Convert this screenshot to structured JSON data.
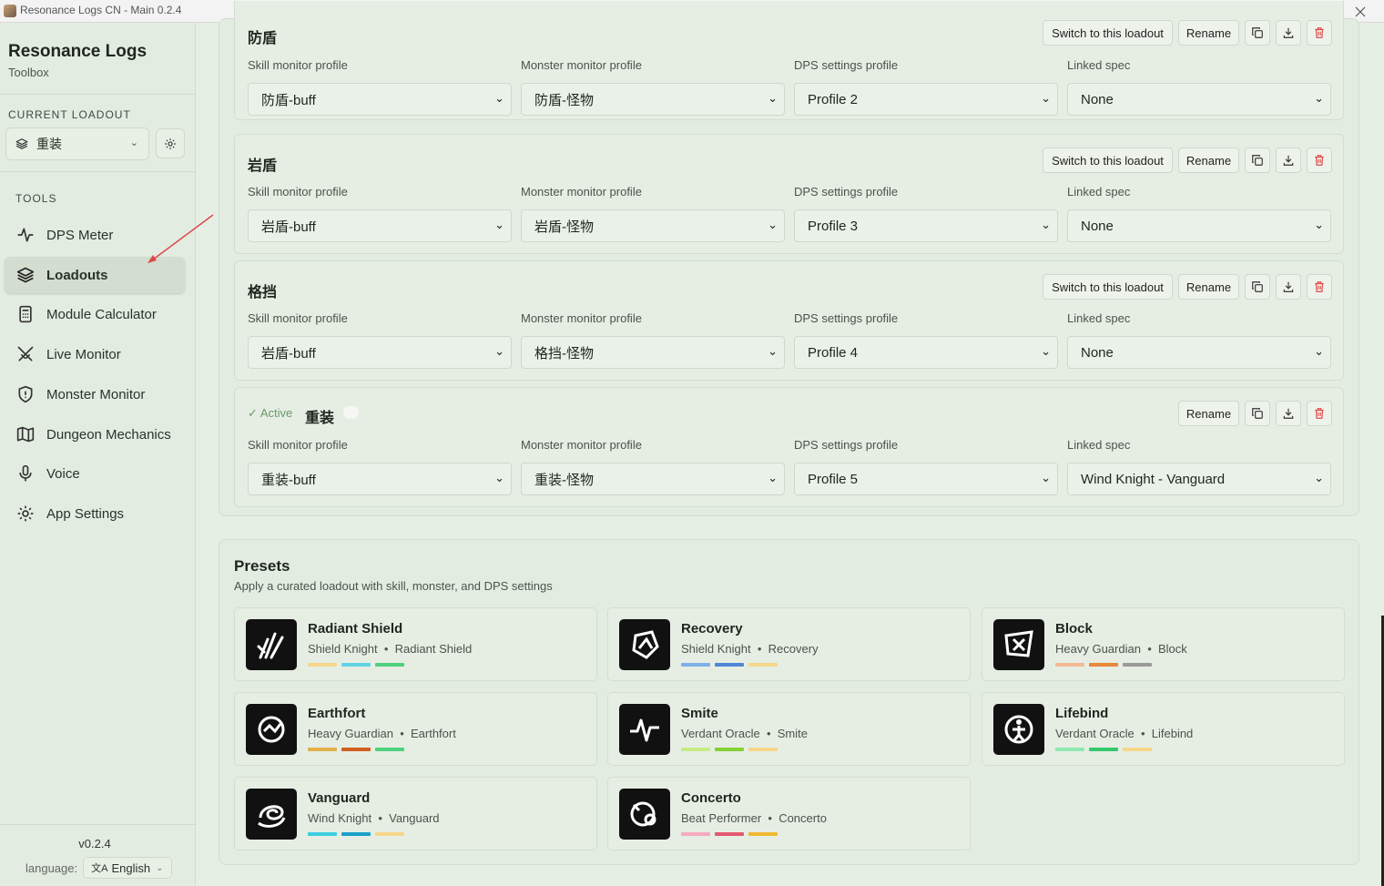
{
  "window": {
    "title": "Resonance Logs CN - Main 0.2.4"
  },
  "sidebar": {
    "app_name": "Resonance Logs",
    "app_sub": "Toolbox",
    "current_loadout_label": "CURRENT LOADOUT",
    "current_loadout_value": "重装",
    "tools_label": "TOOLS",
    "items": [
      {
        "label": "DPS Meter",
        "icon": "pulse-icon"
      },
      {
        "label": "Loadouts",
        "icon": "layers-icon"
      },
      {
        "label": "Module Calculator",
        "icon": "calculator-icon"
      },
      {
        "label": "Live Monitor",
        "icon": "swords-icon"
      },
      {
        "label": "Monster Monitor",
        "icon": "shield-icon"
      },
      {
        "label": "Dungeon Mechanics",
        "icon": "map-icon"
      },
      {
        "label": "Voice",
        "icon": "mic-icon"
      },
      {
        "label": "App Settings",
        "icon": "gear-icon"
      }
    ],
    "version": "v0.2.4",
    "language_label": "language:",
    "language_value": "English"
  },
  "labels": {
    "skill": "Skill monitor profile",
    "monster": "Monster monitor profile",
    "dps": "DPS settings profile",
    "spec": "Linked spec",
    "switch": "Switch to this loadout",
    "rename": "Rename",
    "active": "Active"
  },
  "loadouts": [
    {
      "name": "防盾",
      "skill": "防盾-buff",
      "monster": "防盾-怪物",
      "dps": "Profile 2",
      "spec": "None"
    },
    {
      "name": "岩盾",
      "skill": "岩盾-buff",
      "monster": "岩盾-怪物",
      "dps": "Profile 3",
      "spec": "None"
    },
    {
      "name": "格挡",
      "skill": "岩盾-buff",
      "monster": "格挡-怪物",
      "dps": "Profile 4",
      "spec": "None"
    },
    {
      "name": "重装",
      "skill": "重装-buff",
      "monster": "重装-怪物",
      "dps": "Profile 5",
      "spec": "Wind Knight - Vanguard"
    }
  ],
  "presets": {
    "title": "Presets",
    "subtitle": "Apply a curated loadout with skill, monster, and DPS settings",
    "separator": "•",
    "items": [
      {
        "name": "Radiant Shield",
        "class": "Shield Knight",
        "spec": "Radiant Shield",
        "colors": [
          "#f6d68a",
          "#5fd3e6",
          "#4fd17e"
        ]
      },
      {
        "name": "Recovery",
        "class": "Shield Knight",
        "spec": "Recovery",
        "colors": [
          "#7fb0e8",
          "#4f86d6",
          "#f6d68a"
        ]
      },
      {
        "name": "Block",
        "class": "Heavy Guardian",
        "spec": "Block",
        "colors": [
          "#f3b993",
          "#e8883a",
          "#9a9a9a"
        ]
      },
      {
        "name": "Earthfort",
        "class": "Heavy Guardian",
        "spec": "Earthfort",
        "colors": [
          "#e0b04a",
          "#d0601e",
          "#4fd17e"
        ]
      },
      {
        "name": "Smite",
        "class": "Verdant Oracle",
        "spec": "Smite",
        "colors": [
          "#c8ec84",
          "#84d234",
          "#f6d68a"
        ]
      },
      {
        "name": "Lifebind",
        "class": "Verdant Oracle",
        "spec": "Lifebind",
        "colors": [
          "#8fe8b2",
          "#34c86a",
          "#f6d68a"
        ]
      },
      {
        "name": "Vanguard",
        "class": "Wind Knight",
        "spec": "Vanguard",
        "colors": [
          "#3ccde0",
          "#1aa0c8",
          "#f6d68a"
        ]
      },
      {
        "name": "Concerto",
        "class": "Beat Performer",
        "spec": "Concerto",
        "colors": [
          "#f4aabe",
          "#e45870",
          "#f0b830"
        ]
      }
    ]
  }
}
